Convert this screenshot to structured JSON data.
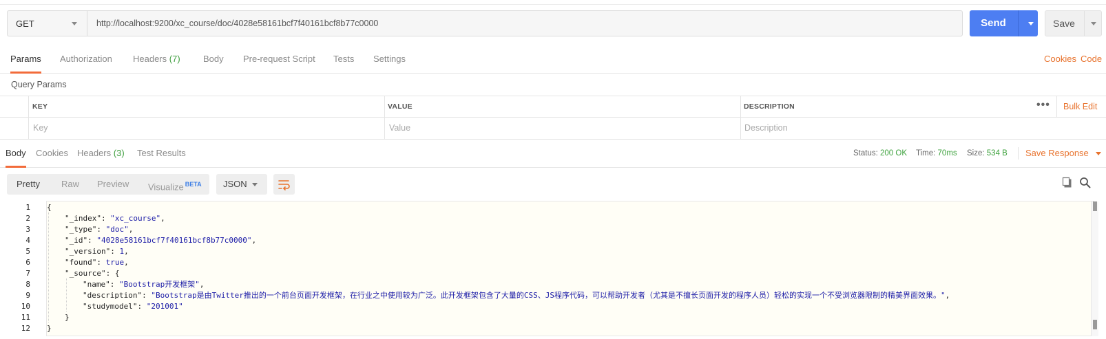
{
  "request": {
    "method": "GET",
    "url": "http://localhost:9200/xc_course/doc/4028e58161bcf7f40161bcf8b77c0000",
    "send_label": "Send",
    "save_label": "Save"
  },
  "request_tabs": {
    "params": "Params",
    "authorization": "Authorization",
    "headers": "Headers",
    "headers_count": "(7)",
    "body": "Body",
    "prerequest": "Pre-request Script",
    "tests": "Tests",
    "settings": "Settings",
    "cookies_link": "Cookies",
    "code_link": "Code"
  },
  "query_params": {
    "title": "Query Params",
    "columns": {
      "key": "KEY",
      "value": "VALUE",
      "description": "DESCRIPTION"
    },
    "bulk_edit": "Bulk Edit",
    "placeholders": {
      "key": "Key",
      "value": "Value",
      "description": "Description"
    }
  },
  "response_tabs": {
    "body": "Body",
    "cookies": "Cookies",
    "headers": "Headers",
    "headers_count": "(3)",
    "test_results": "Test Results"
  },
  "status": {
    "status_label": "Status:",
    "status_value": "200 OK",
    "time_label": "Time:",
    "time_value": "70ms",
    "size_label": "Size:",
    "size_value": "534 B",
    "save_response": "Save Response"
  },
  "view": {
    "pretty": "Pretty",
    "raw": "Raw",
    "preview": "Preview",
    "visualize": "Visualize",
    "beta": "BETA",
    "format": "JSON"
  },
  "code": {
    "line_numbers": [
      "1",
      "2",
      "3",
      "4",
      "5",
      "6",
      "7",
      "8",
      "9",
      "10",
      "11",
      "12"
    ],
    "l1": "{",
    "index_key": "\"_index\"",
    "index_val": "\"xc_course\"",
    "type_key": "\"_type\"",
    "type_val": "\"doc\"",
    "id_key": "\"_id\"",
    "id_val": "\"4028e58161bcf7f40161bcf8b77c0000\"",
    "version_key": "\"_version\"",
    "version_val": "1",
    "found_key": "\"found\"",
    "found_val": "true",
    "source_key": "\"_source\"",
    "name_key": "\"name\"",
    "name_val": "\"Bootstrap开发框架\"",
    "desc_key": "\"description\"",
    "desc_val": "\"Bootstrap是由Twitter推出的一个前台页面开发框架，在行业之中使用较为广泛。此开发框架包含了大量的CSS、JS程序代码，可以帮助开发者（尤其是不擅长页面开发的程序人员）轻松的实现一个不受浏览器限制的精美界面效果。\"",
    "study_key": "\"studymodel\"",
    "study_val": "\"201001\"",
    "l11": "}",
    "l12": "}"
  },
  "icons": {
    "copy": "copy-icon",
    "search": "search-icon",
    "wrap": "wrap-lines-icon",
    "more": "more-dots-icon"
  },
  "colors": {
    "accent": "#f26b3a",
    "send": "#4d7ef2",
    "status_ok": "#3ea23e",
    "link": "#e8732e",
    "json_value": "#1a1aa6"
  }
}
